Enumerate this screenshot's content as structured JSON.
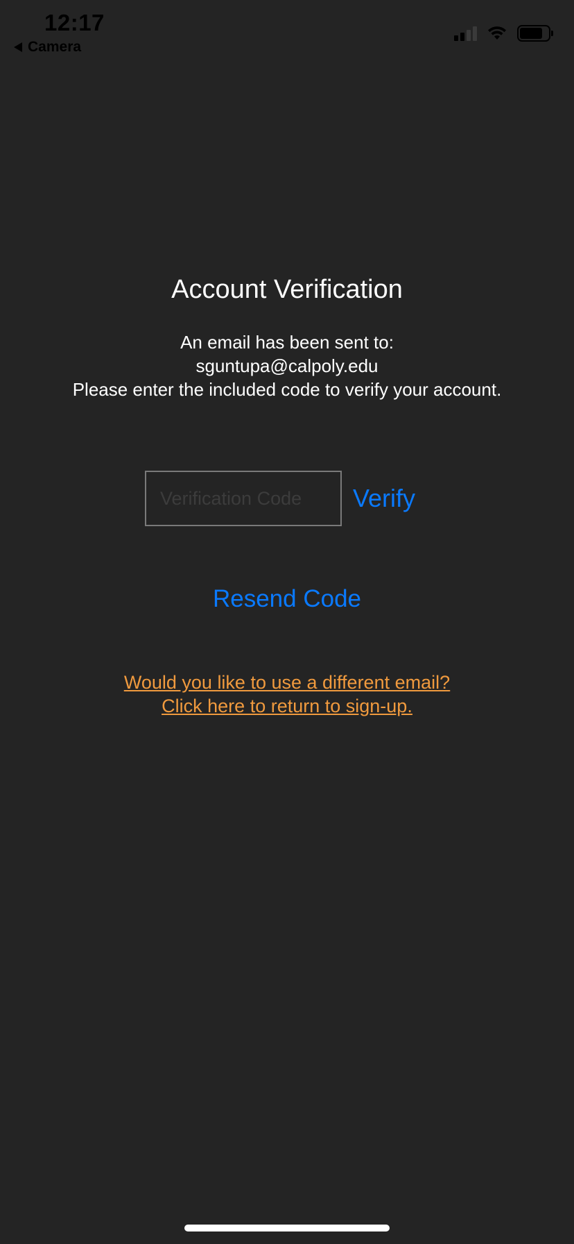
{
  "status_bar": {
    "time": "12:17",
    "back_app_label": "Camera",
    "icons": [
      "cellular-signal-icon",
      "wifi-icon",
      "battery-icon"
    ]
  },
  "verification": {
    "title": "Account Verification",
    "message_line1": "An email has been sent to:",
    "email": "sguntupa@calpoly.edu",
    "message_line3": "Please enter the included code to verify your account.",
    "code_placeholder": "Verification Code",
    "code_value": "",
    "verify_label": "Verify",
    "resend_label": "Resend Code",
    "different_email_line1": "Would you like to use a different email?",
    "different_email_line2": "Click here to return to sign-up."
  },
  "colors": {
    "background": "#242424",
    "accent_blue": "#0a7aff",
    "link_orange": "#f09a3e"
  }
}
